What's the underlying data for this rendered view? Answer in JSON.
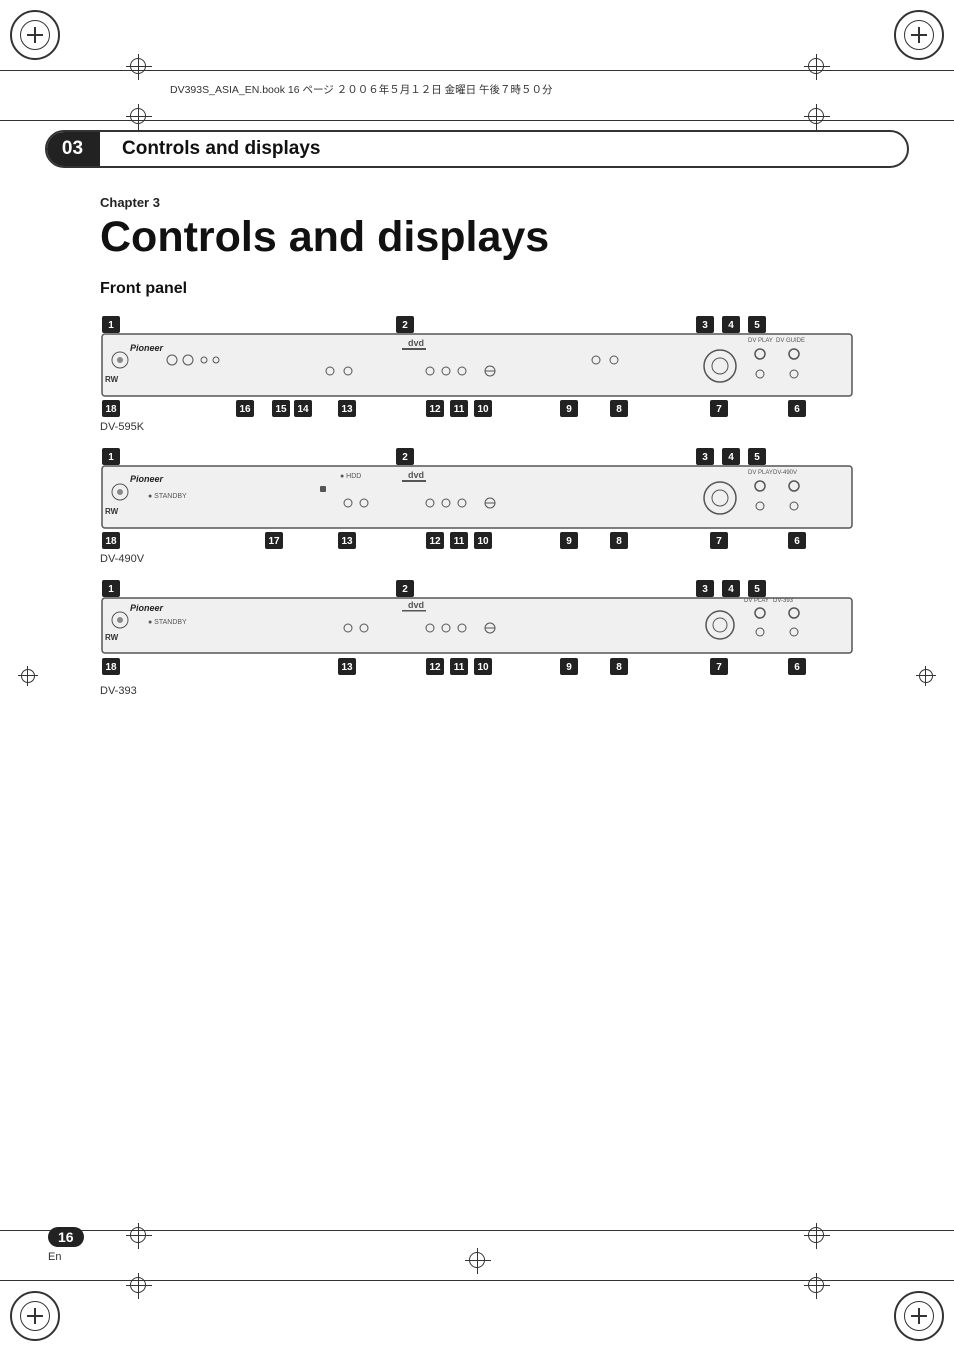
{
  "page": {
    "header": {
      "file_info": "DV393S_ASIA_EN.book  16 ページ  ２００６年５月１２日  金曜日  午後７時５０分"
    },
    "chapter_bar": {
      "number": "03",
      "title": "Controls and displays"
    },
    "main": {
      "chapter_label": "Chapter 3",
      "main_title": "Controls and displays",
      "section_title": "Front panel",
      "devices": [
        {
          "model": "DV-595K",
          "numbers_bottom": [
            "18",
            "16",
            "15",
            "14",
            "13",
            "12",
            "11",
            "10",
            "9",
            "8",
            "7",
            "6"
          ],
          "numbers_top": [
            "1",
            "2",
            "3",
            "4",
            "5"
          ]
        },
        {
          "model": "DV-490V",
          "numbers_bottom": [
            "18",
            "17",
            "13",
            "12",
            "11",
            "10",
            "9",
            "8",
            "7",
            "6"
          ],
          "numbers_top": [
            "1",
            "2",
            "3",
            "4",
            "5"
          ]
        },
        {
          "model": "DV-393",
          "numbers_bottom": [
            "18",
            "13",
            "12",
            "11",
            "10",
            "9",
            "8",
            "7",
            "6"
          ],
          "numbers_top": [
            "1",
            "2",
            "3",
            "4",
            "5"
          ]
        }
      ]
    },
    "footer": {
      "page_number": "16",
      "language": "En"
    }
  }
}
